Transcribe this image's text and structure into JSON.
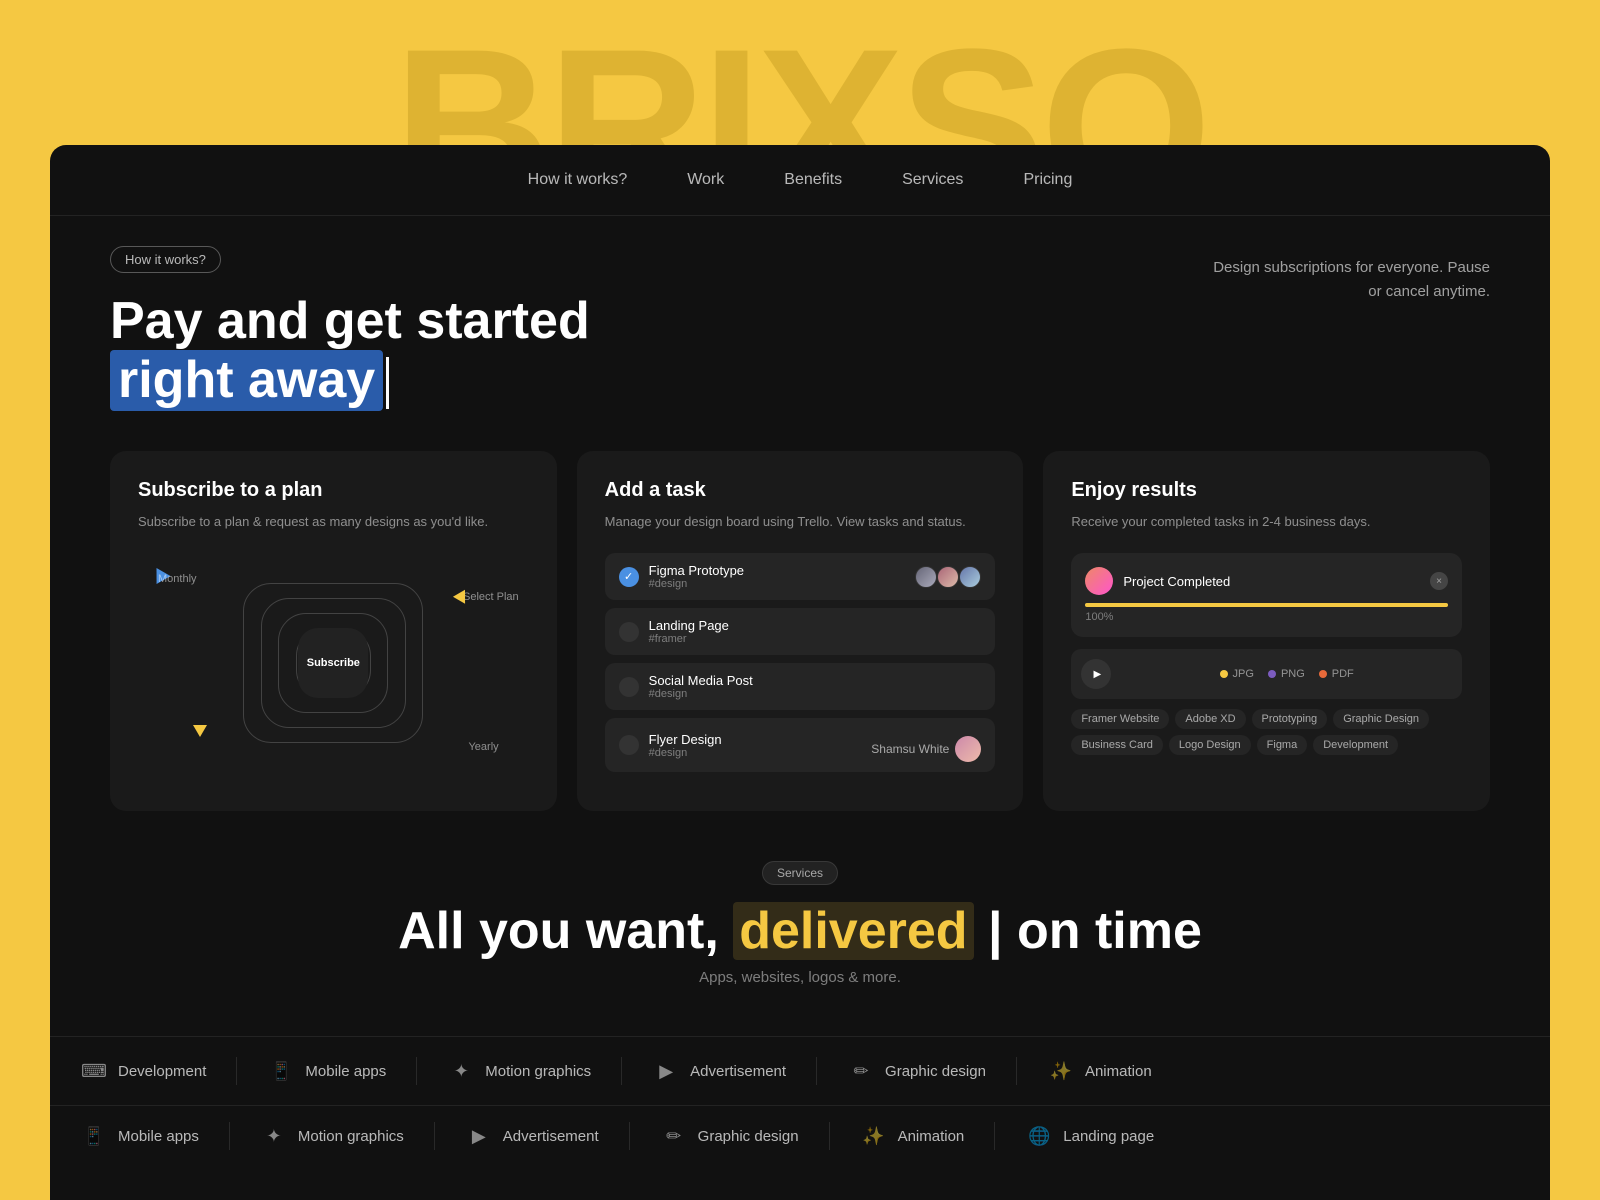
{
  "bgText": "BRIXSO",
  "nav": {
    "items": [
      {
        "label": "How it works?",
        "id": "how-it-works"
      },
      {
        "label": "Work",
        "id": "work"
      },
      {
        "label": "Benefits",
        "id": "benefits"
      },
      {
        "label": "Services",
        "id": "services"
      },
      {
        "label": "Pricing",
        "id": "pricing"
      }
    ]
  },
  "hero": {
    "badge": "How it works?",
    "title_line1": "Pay and get started",
    "title_line2_plain": "right away",
    "subtitle": "Design subscriptions for everyone. Pause or cancel anytime."
  },
  "cards": {
    "card1": {
      "title": "Subscribe to a plan",
      "desc": "Subscribe to a plan & request as many designs as you'd like.",
      "label_monthly": "Monthly",
      "label_select": "Select Plan",
      "label_subscribe": "Subscribe",
      "label_yearly": "Yearly"
    },
    "card2": {
      "title": "Add a task",
      "desc": "Manage your design board using Trello. View tasks and status.",
      "tasks": [
        {
          "name": "Figma Prototype",
          "tag": "#design",
          "done": true
        },
        {
          "name": "Landing Page",
          "tag": "#framer",
          "done": false
        },
        {
          "name": "Social Media Post",
          "tag": "#design",
          "done": false
        },
        {
          "name": "Flyer Design",
          "tag": "#design",
          "done": false
        }
      ],
      "user_name": "Shamsu White"
    },
    "card3": {
      "title": "Enjoy results",
      "desc": "Receive your completed tasks in 2-4 business days.",
      "project_title": "Project Completed",
      "progress": "100%",
      "file_types": [
        "JPG",
        "PNG",
        "PDF"
      ],
      "tags": [
        "Framer Website",
        "Adobe XD",
        "Prototyping",
        "Graphic Design",
        "Business Card",
        "Logo Design",
        "Figma",
        "Development"
      ]
    }
  },
  "services_section": {
    "badge": "Services",
    "title_start": "All you want,",
    "title_highlight": "delivered",
    "title_end": "on time",
    "subtitle": "Apps, websites, logos & more.",
    "items_row1": [
      {
        "icon": "📱",
        "label": "Mobile apps"
      },
      {
        "icon": "✦",
        "label": "Motion graphics"
      },
      {
        "icon": "▶",
        "label": "Advertisement"
      },
      {
        "icon": "✏",
        "label": "Graphic design"
      },
      {
        "icon": "✨",
        "label": "Animation"
      }
    ],
    "items_row2": [
      {
        "icon": "📱",
        "label": "Mobile apps"
      },
      {
        "icon": "✦",
        "label": "Motion graphics"
      },
      {
        "icon": "▶",
        "label": "Advertisement"
      },
      {
        "icon": "✏",
        "label": "Graphic design"
      },
      {
        "icon": "✨",
        "label": "Animation"
      },
      {
        "icon": "🌐",
        "label": "Landing page"
      }
    ]
  }
}
